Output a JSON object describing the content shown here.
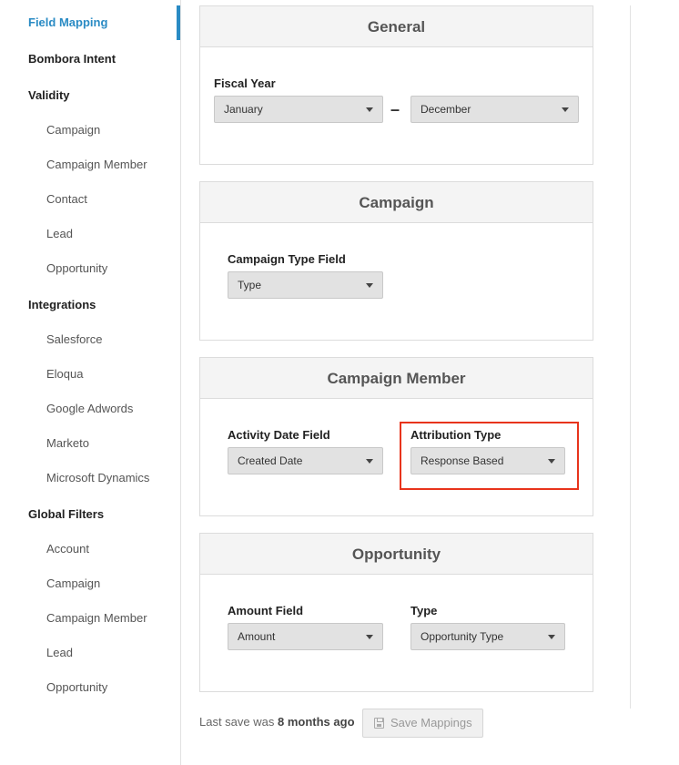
{
  "sidebar": {
    "items": [
      {
        "label": "Field Mapping",
        "type": "section",
        "active": true
      },
      {
        "label": "Bombora Intent",
        "type": "section"
      },
      {
        "label": "Validity",
        "type": "section"
      },
      {
        "label": "Campaign",
        "type": "sub"
      },
      {
        "label": "Campaign Member",
        "type": "sub"
      },
      {
        "label": "Contact",
        "type": "sub"
      },
      {
        "label": "Lead",
        "type": "sub"
      },
      {
        "label": "Opportunity",
        "type": "sub"
      },
      {
        "label": "Integrations",
        "type": "section"
      },
      {
        "label": "Salesforce",
        "type": "sub"
      },
      {
        "label": "Eloqua",
        "type": "sub"
      },
      {
        "label": "Google Adwords",
        "type": "sub"
      },
      {
        "label": "Marketo",
        "type": "sub"
      },
      {
        "label": "Microsoft Dynamics",
        "type": "sub"
      },
      {
        "label": "Global Filters",
        "type": "section"
      },
      {
        "label": "Account",
        "type": "sub"
      },
      {
        "label": "Campaign",
        "type": "sub"
      },
      {
        "label": "Campaign Member",
        "type": "sub"
      },
      {
        "label": "Lead",
        "type": "sub"
      },
      {
        "label": "Opportunity",
        "type": "sub"
      }
    ]
  },
  "general": {
    "title": "General",
    "fiscal_year_label": "Fiscal Year",
    "from_month": "January",
    "separator": "–",
    "to_month": "December"
  },
  "campaign": {
    "title": "Campaign",
    "type_field_label": "Campaign Type Field",
    "type_field_value": "Type"
  },
  "campaign_member": {
    "title": "Campaign Member",
    "activity_date_label": "Activity Date Field",
    "activity_date_value": "Created Date",
    "attribution_type_label": "Attribution Type",
    "attribution_type_value": "Response Based"
  },
  "opportunity": {
    "title": "Opportunity",
    "amount_label": "Amount Field",
    "amount_value": "Amount",
    "type_label": "Type",
    "type_value": "Opportunity Type"
  },
  "footer": {
    "last_save_prefix": "Last save was",
    "last_save_time": "8 months ago",
    "save_button_label": "Save Mappings"
  },
  "colors": {
    "accent": "#2a8bc4",
    "highlight": "#e8341c"
  }
}
